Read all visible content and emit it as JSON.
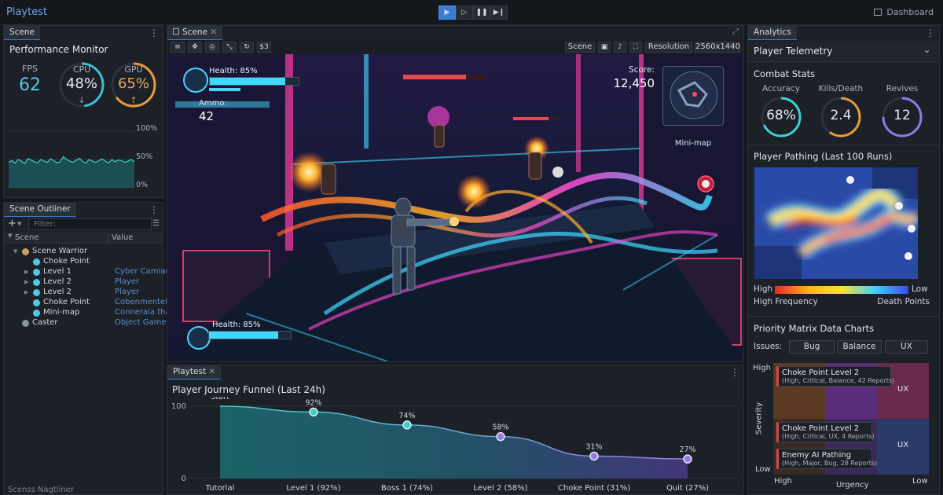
{
  "app": {
    "title": "Playtest",
    "dashboard_label": "Dashboard"
  },
  "toolbar": {
    "play": "▶",
    "step": "▷",
    "pause": "❚❚",
    "skip": "▶❙"
  },
  "scene_panel": {
    "tab": "Scene"
  },
  "performance": {
    "title": "Performance Monitor",
    "fps_label": "FPS",
    "fps_value": "62",
    "cpu_label": "CPU",
    "cpu_value": "48%",
    "cpu_level": 0.48,
    "cpu_arrow": "↓",
    "gpu_label": "GPU",
    "gpu_value": "65%",
    "gpu_level": 0.65,
    "gpu_arrow": "↑",
    "graph_ticks": [
      "100%",
      "50%",
      "0%"
    ],
    "graph_values": [
      0.45,
      0.48,
      0.44,
      0.5,
      0.47,
      0.43,
      0.52,
      0.49,
      0.46,
      0.44,
      0.5,
      0.47,
      0.45,
      0.51,
      0.48,
      0.44,
      0.46,
      0.55,
      0.5,
      0.47,
      0.45,
      0.49,
      0.52,
      0.46,
      0.44,
      0.5,
      0.47,
      0.45,
      0.48,
      0.51,
      0.47,
      0.44,
      0.5,
      0.46,
      0.49,
      0.48,
      0.45,
      0.47,
      0.5,
      0.46
    ]
  },
  "outliner": {
    "tab": "Scene Outliner",
    "filter_placeholder": "Filter:",
    "col_scene": "Scene",
    "col_value": "Value",
    "rows": [
      {
        "name": "Scene Warrior",
        "value": "",
        "depth": 1,
        "expand": "▼"
      },
      {
        "name": "Choke Point",
        "value": "",
        "depth": 2,
        "expand": ""
      },
      {
        "name": "Level 1",
        "value": "Cyber Camian",
        "depth": 2,
        "expand": "▶"
      },
      {
        "name": "Level 2",
        "value": "Player",
        "depth": 2,
        "expand": "▶"
      },
      {
        "name": "Level 2",
        "value": "Player",
        "depth": 2,
        "expand": "▶"
      },
      {
        "name": "Choke Point",
        "value": "Cobenmentell",
        "depth": 2,
        "expand": ""
      },
      {
        "name": "Mini-map",
        "value": "Conneraia tha",
        "depth": 2,
        "expand": ""
      },
      {
        "name": "Caster",
        "value": "Object Games",
        "depth": 1,
        "expand": ""
      }
    ],
    "footer": "Scenss Nagtliner"
  },
  "viewport": {
    "tab": "Scene",
    "mode_label": "Scene",
    "resolution_label": "Resolution",
    "resolution_value": "2560x1440",
    "hud": {
      "health_label": "Health: 85%",
      "health_level": 0.85,
      "ammo_label": "Ammo:",
      "ammo_value": "42",
      "score_label": "Score:",
      "score_value": "12,450",
      "minimap_label": "Mini-map",
      "health2_label": "Health: 85%",
      "health2_level": 0.85
    }
  },
  "funnel": {
    "tab": "Playtest",
    "title": "Player Journey Funnel (Last 24h)",
    "chart_data": {
      "type": "area",
      "title": "Player Journey Funnel (Last 24h)",
      "categories": [
        "Tutorial",
        "Level 1 (92%)",
        "Boss 1 (74%)",
        "Level 2 (58%)",
        "Choke Point (31%)",
        "Quit (27%)"
      ],
      "values": [
        100,
        92,
        74,
        58,
        31,
        27
      ],
      "point_labels": [
        "Start",
        "92%",
        "74%",
        "58%",
        "31%",
        "27%"
      ],
      "ylim": [
        0,
        100
      ],
      "yticks": [
        "100",
        "0"
      ]
    }
  },
  "analytics": {
    "tab": "Analytics",
    "telemetry_title": "Player Telemetry",
    "combat_title": "Combat Stats",
    "accuracy_label": "Accuracy",
    "accuracy_value": "68%",
    "accuracy_level": 0.68,
    "kd_label": "Kills/Death",
    "kd_value": "2.4",
    "kd_level": 0.6,
    "revives_label": "Revives",
    "revives_value": "12",
    "revives_level": 0.75,
    "pathing_title": "Player Pathing (Last 100 Runs)",
    "legend_high": "High",
    "legend_low": "Low",
    "legend_high_freq": "High Frequency",
    "legend_death": "Death Points",
    "priority_title": "Priority Matrix Data Charts",
    "issues_label": "Issues:",
    "issue_buttons": [
      "Bug",
      "Balance",
      "UX"
    ],
    "axis_high": "High",
    "axis_low": "Low",
    "axis_severity": "Severity",
    "axis_urgency": "Urgency",
    "axis_x_high": "High",
    "axis_x_low": "Low",
    "cell_labels": [
      "UX",
      "UX"
    ],
    "tooltips": [
      {
        "title": "Choke Point Level 2",
        "detail": "(High, Critical, Balance, 42 Reports)"
      },
      {
        "title": "Choke Point Level 2",
        "detail": "(High, Critical, UX, 4 Reports)"
      },
      {
        "title": "Enemy AI Pathing",
        "detail": "(High, Major, Bug, 28 Reports)"
      }
    ],
    "colors": {
      "cyan": "#3fd0d8",
      "orange": "#e89a3a",
      "purple": "#8a7ce8"
    }
  }
}
